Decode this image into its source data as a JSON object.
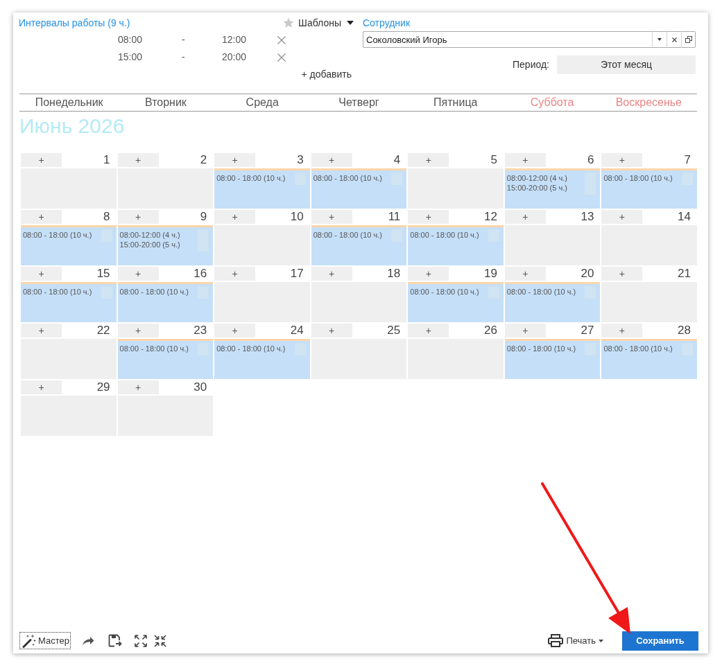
{
  "intervals": {
    "title": "Интервалы работы (9 ч.)",
    "rows": [
      {
        "start": "08:00",
        "separator": "-",
        "end": "12:00"
      },
      {
        "start": "15:00",
        "separator": "-",
        "end": "20:00"
      }
    ],
    "add_label": "+ добавить"
  },
  "templates": {
    "label": "Шаблоны"
  },
  "employee": {
    "label": "Сотрудник",
    "value": "Соколовский Игорь"
  },
  "period": {
    "label": "Период:",
    "value": "Этот месяц"
  },
  "weekdays": [
    {
      "label": "Понедельник",
      "weekend": false
    },
    {
      "label": "Вторник",
      "weekend": false
    },
    {
      "label": "Среда",
      "weekend": false
    },
    {
      "label": "Четверг",
      "weekend": false
    },
    {
      "label": "Пятница",
      "weekend": false
    },
    {
      "label": "Суббота",
      "weekend": true
    },
    {
      "label": "Воскресенье",
      "weekend": true
    }
  ],
  "month_title": "Июнь 2026",
  "days": [
    {
      "day": "1",
      "add_button": "+"
    },
    {
      "day": "2",
      "add_button": "+"
    },
    {
      "day": "3",
      "add_button": "+",
      "shifts": [
        "08:00 - 18:00 (10 ч.)"
      ]
    },
    {
      "day": "4",
      "add_button": "+",
      "shifts": [
        "08:00 - 18:00 (10 ч.)"
      ]
    },
    {
      "day": "5",
      "add_button": "+"
    },
    {
      "day": "6",
      "add_button": "+",
      "shifts": [
        "08:00-12:00 (4 ч.)",
        "15:00-20:00 (5 ч.)"
      ]
    },
    {
      "day": "7",
      "add_button": "+",
      "shifts": [
        "08:00 - 18:00 (10 ч.)"
      ]
    },
    {
      "day": "8",
      "add_button": "+",
      "shifts": [
        "08:00 - 18:00 (10 ч.)"
      ]
    },
    {
      "day": "9",
      "add_button": "+",
      "shifts": [
        "08:00-12:00 (4 ч.)",
        "15:00-20:00 (5 ч.)"
      ]
    },
    {
      "day": "10",
      "add_button": "+"
    },
    {
      "day": "11",
      "add_button": "+",
      "shifts": [
        "08:00 - 18:00 (10 ч.)"
      ]
    },
    {
      "day": "12",
      "add_button": "+",
      "shifts": [
        "08:00 - 18:00 (10 ч.)"
      ]
    },
    {
      "day": "13",
      "add_button": "+"
    },
    {
      "day": "14",
      "add_button": "+"
    },
    {
      "day": "15",
      "add_button": "+",
      "shifts": [
        "08:00 - 18:00 (10 ч.)"
      ]
    },
    {
      "day": "16",
      "add_button": "+",
      "shifts": [
        "08:00 - 18:00 (10 ч.)"
      ]
    },
    {
      "day": "17",
      "add_button": "+"
    },
    {
      "day": "18",
      "add_button": "+"
    },
    {
      "day": "19",
      "add_button": "+",
      "shifts": [
        "08:00 - 18:00 (10 ч.)"
      ]
    },
    {
      "day": "20",
      "add_button": "+",
      "shifts": [
        "08:00 - 18:00 (10 ч.)"
      ]
    },
    {
      "day": "21",
      "add_button": "+"
    },
    {
      "day": "22",
      "add_button": "+"
    },
    {
      "day": "23",
      "add_button": "+",
      "shifts": [
        "08:00 - 18:00 (10 ч.)"
      ]
    },
    {
      "day": "24",
      "add_button": "+",
      "shifts": [
        "08:00 - 18:00 (10 ч.)"
      ]
    },
    {
      "day": "25",
      "add_button": "+"
    },
    {
      "day": "26",
      "add_button": "+"
    },
    {
      "day": "27",
      "add_button": "+",
      "shifts": [
        "08:00 - 18:00 (10 ч.)"
      ]
    },
    {
      "day": "28",
      "add_button": "+",
      "shifts": [
        "08:00 - 18:00 (10 ч.)"
      ]
    },
    {
      "day": "29",
      "add_button": "+"
    },
    {
      "day": "30",
      "add_button": "+"
    }
  ],
  "toolbar": {
    "wizard_button": "Мастер",
    "print_button": "Печать",
    "save_button": "Сохранить"
  }
}
